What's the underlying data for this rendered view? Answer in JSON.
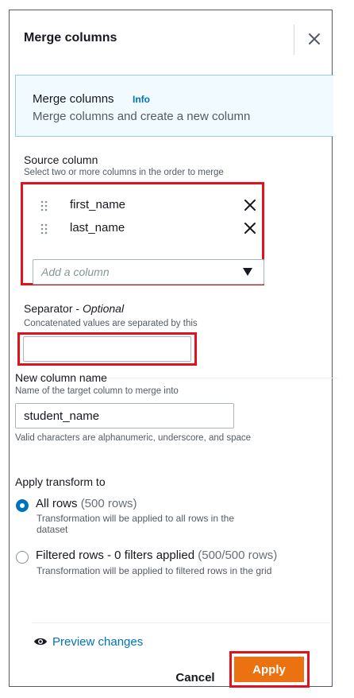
{
  "header": {
    "title": "Merge columns"
  },
  "info_panel": {
    "title": "Merge columns",
    "info_link": "Info",
    "description": "Merge columns and create a new column"
  },
  "source_column": {
    "label": "Source column",
    "description": "Select two or more columns in the order to merge",
    "items": [
      {
        "name": "first_name"
      },
      {
        "name": "last_name"
      }
    ],
    "add_placeholder": "Add a column"
  },
  "separator": {
    "label": "Separator - ",
    "label_optional": "Optional",
    "description": "Concatenated values are separated by this",
    "value": ""
  },
  "new_column": {
    "label": "New column name",
    "description": "Name of the target column to merge into",
    "value": "student_name",
    "hint": "Valid characters are alphanumeric, underscore, and space"
  },
  "apply_transform": {
    "label": "Apply transform to",
    "options": [
      {
        "label": "All rows",
        "count": "(500 rows)",
        "description": "Transformation will be applied to all rows in the dataset",
        "selected": true
      },
      {
        "label": "Filtered rows - 0 filters applied",
        "count": "(500/500 rows)",
        "description": "Transformation will be applied to filtered rows in the grid",
        "selected": false
      }
    ]
  },
  "footer": {
    "preview_label": "Preview changes",
    "cancel_label": "Cancel",
    "apply_label": "Apply"
  },
  "colors": {
    "primary": "#ec7211",
    "link": "#0073bb",
    "highlight": "#e0121e",
    "info_bg": "#f1faff"
  }
}
